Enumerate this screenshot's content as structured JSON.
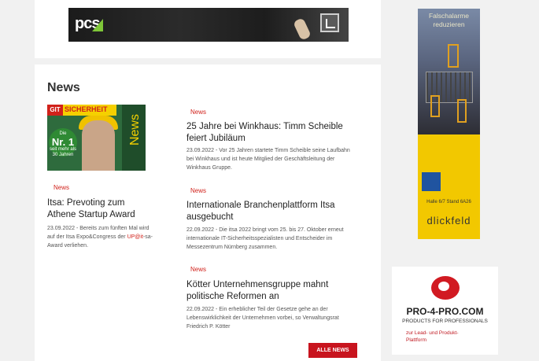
{
  "banner_top": {
    "logo_text": "pcs"
  },
  "news": {
    "heading": "News",
    "featured": {
      "magazine": {
        "brand": "GIT",
        "title": "SICHERHEIT",
        "badge_line1": "Die",
        "badge_number": "Nr. 1",
        "badge_line2": "seit mehr als",
        "badge_line3": "30 Jahren",
        "side_label": "News"
      },
      "tag": "News",
      "title": "Itsa: Prevoting zum Athene Startup Award",
      "meta_before": "23.09.2022 - Bereits zum fünften Mal wird auf der Itsa Expo&Congress der ",
      "meta_highlight": "UP@it",
      "meta_after": "-sa-Award verliehen."
    },
    "items": [
      {
        "tag": "News",
        "title": "25 Jahre bei Winkhaus: Timm Scheible feiert Jubiläum",
        "meta": "23.09.2022 - Vor 25 Jahren startete Timm Scheible seine Laufbahn bei Winkhaus und ist heute Mitglied der Geschäftsleitung der Winkhaus Gruppe."
      },
      {
        "tag": "News",
        "title": "Internationale Branchenplattform Itsa ausgebucht",
        "meta": "22.09.2022 - Die itsa 2022 bringt vom 25. bis 27. Oktober erneut internationale IT-Sicherheitsspezialisten und Entscheider im Messezentrum Nürnberg zusammen."
      },
      {
        "tag": "News",
        "title": "Kötter Unternehmensgruppe mahnt politische Reformen an",
        "meta": "22.09.2022 - Ein erheblicher Teil der Gesetze gehe an der Lebenswirklichkeit der Unternehmen vorbei, so Verwaltungsrat Friedrich P. Kötter"
      }
    ],
    "all_news_button": "ALLE NEWS"
  },
  "ads": {
    "dallmeier": {
      "headline_1": "Falschalarme",
      "headline_2": "reduzieren",
      "hall": "Halle 6/7 Stand 6A26",
      "brand": "dlickfeld"
    },
    "pro4pro": {
      "title": "PRO-4-PRO.COM",
      "subtitle": "PRODUCTS FOR PROFESSIONALS",
      "note_1": "zur Lead- und Produkt-",
      "note_2": "Plattform"
    }
  },
  "colors": {
    "accent_red": "#c8141e",
    "tag_red": "#d1221b",
    "ad_yellow": "#f2c800"
  }
}
